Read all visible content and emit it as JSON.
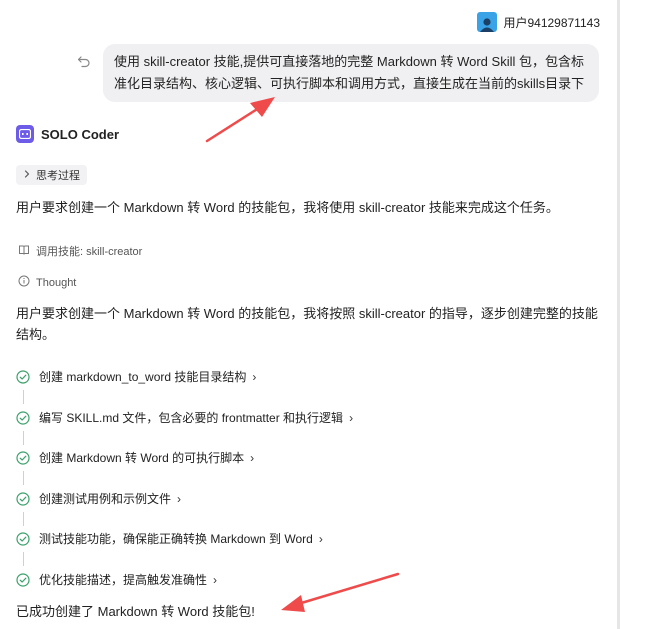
{
  "user": {
    "name": "用户94129871143",
    "avatar_icon": "user-avatar-icon"
  },
  "message": {
    "text": "使用 skill-creator 技能,提供可直接落地的完整 Markdown 转 Word Skill 包，包含标准化目录结构、核心逻辑、可执行脚本和调用方式，直接生成在当前的skills目录下"
  },
  "bot": {
    "name": "SOLO Coder",
    "icon": "robot-icon"
  },
  "thinking": {
    "label": "思考过程",
    "icon": "chevron-right-icon"
  },
  "intro": "用户要求创建一个 Markdown 转 Word 的技能包，我将使用 skill-creator 技能来完成这个任务。",
  "skill_call": {
    "label": "调用技能: skill-creator",
    "icon": "book-icon"
  },
  "thought": {
    "label": "Thought",
    "icon": "info-icon"
  },
  "plan_text": "用户要求创建一个 Markdown 转 Word 的技能包，我将按照 skill-creator 的指导，逐步创建完整的技能结构。",
  "steps": [
    {
      "label": "创建 markdown_to_word 技能目录结构",
      "status": "done"
    },
    {
      "label": "编写 SKILL.md 文件，包含必要的 frontmatter 和执行逻辑",
      "status": "done"
    },
    {
      "label": "创建 Markdown 转 Word 的可执行脚本",
      "status": "done"
    },
    {
      "label": "创建测试用例和示例文件",
      "status": "done"
    },
    {
      "label": "测试技能功能，确保能正确转换 Markdown 到 Word",
      "status": "done"
    },
    {
      "label": "优化技能描述，提高触发准确性",
      "status": "done"
    }
  ],
  "final_message": "已成功创建了 Markdown 转 Word 技能包!",
  "colors": {
    "accent_check": "#3aa06a",
    "annotation_arrow": "#ef4b4b",
    "bubble_bg": "#f0f0f2",
    "bot_icon": "#6c5ce7",
    "avatar": "#3aa2e6"
  }
}
